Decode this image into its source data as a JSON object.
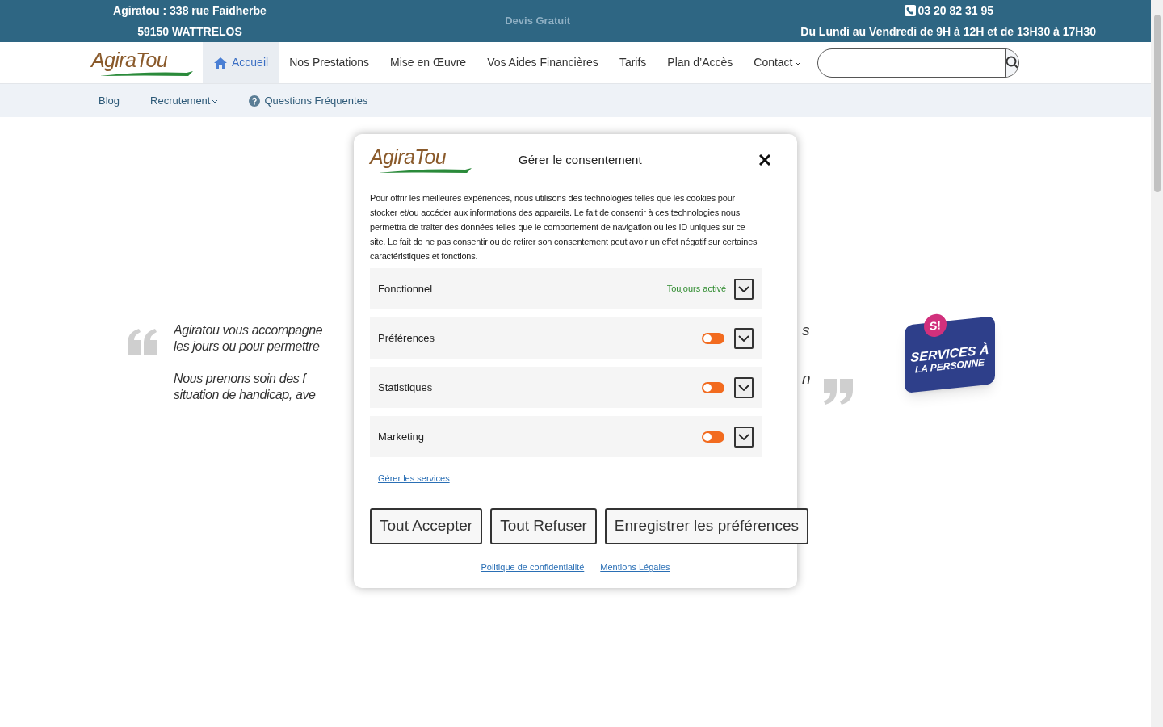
{
  "top_bar": {
    "address_line_1": "Agiratou : 338 rue Faidherbe",
    "address_line_2": "59150 WATTRELOS",
    "quote_link": "Devis Gratuit",
    "phone": "03 20 82 31 95",
    "hours": "Du Lundi au Vendredi de 9H à 12H et de 13H30 à 17H30"
  },
  "logo": {
    "text": "AgiraTou"
  },
  "nav": {
    "items": [
      {
        "label": "Accueil",
        "selected": true,
        "kind": "home"
      },
      {
        "label": "Nos Prestations",
        "selected": false,
        "kind": "plain"
      },
      {
        "label": "Mise en Œuvre",
        "selected": false,
        "kind": "plain"
      },
      {
        "label": "Vos Aides Financières",
        "selected": false,
        "kind": "plain"
      },
      {
        "label": "Tarifs",
        "selected": false,
        "kind": "plain"
      },
      {
        "label": "Plan d’Accès",
        "selected": false,
        "kind": "plain"
      },
      {
        "label": "Contact",
        "selected": false,
        "kind": "dropdown"
      }
    ]
  },
  "sub_nav": {
    "items": [
      {
        "label": "Blog",
        "kind": "plain"
      },
      {
        "label": "Recrutement",
        "kind": "dropdown"
      },
      {
        "label": "Questions Fréquentes",
        "kind": "help"
      }
    ]
  },
  "quote": {
    "left_lines": [
      "Agiratou vous accompagne",
      "les jours ou pour permettre",
      "Nous prenons soin des f",
      "situation de handicap, ave"
    ],
    "right_lines": [
      "s",
      "n"
    ]
  },
  "badge": {
    "mark": "S!",
    "line_1": "SERVICES À",
    "line_2": "LA PERSONNE"
  },
  "consent": {
    "logo_text": "AgiraTou",
    "title": "Gérer le consentement",
    "intro": "Pour offrir les meilleures expériences, nous utilisons des technologies telles que les cookies pour stocker et/ou accéder aux informations des appareils. Le fait de consentir à ces technologies nous permettra de traiter des données telles que le comportement de navigation ou les ID uniques sur ce site. Le fait de ne pas consentir ou de retirer son consentement peut avoir un effet négatif sur certaines caractéristiques et fonctions.",
    "categories": [
      {
        "label": "Fonctionnel",
        "kind": "always",
        "status": "Toujours activé",
        "expanded": false
      },
      {
        "label": "Préférences",
        "kind": "toggle",
        "on": false,
        "expanded": false
      },
      {
        "label": "Statistiques",
        "kind": "toggle",
        "on": false,
        "expanded": false
      },
      {
        "label": "Marketing",
        "kind": "toggle",
        "on": false,
        "expanded": false
      }
    ],
    "services_link": "Gérer les services",
    "buttons": [
      "Tout Accepter",
      "Tout Refuser",
      "Enregistrer les préférences"
    ],
    "footer_links": [
      "Politique de confidentialité",
      "Mentions Légales"
    ]
  }
}
